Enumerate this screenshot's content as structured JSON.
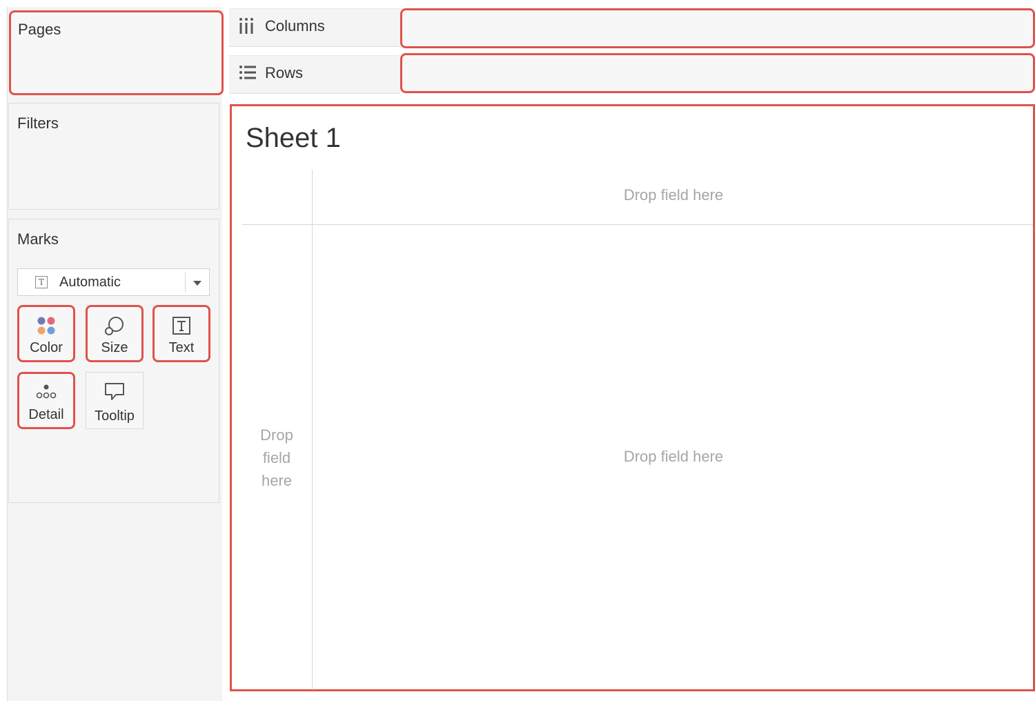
{
  "pages": {
    "title": "Pages"
  },
  "filters": {
    "title": "Filters"
  },
  "marks": {
    "title": "Marks",
    "mark_type": "Automatic",
    "buttons": [
      {
        "label": "Color",
        "icon": "color-dots-icon",
        "highlighted": true
      },
      {
        "label": "Size",
        "icon": "size-icon",
        "highlighted": true
      },
      {
        "label": "Text",
        "icon": "text-icon",
        "highlighted": true
      },
      {
        "label": "Detail",
        "icon": "detail-icon",
        "highlighted": true
      },
      {
        "label": "Tooltip",
        "icon": "tooltip-icon",
        "highlighted": false
      }
    ]
  },
  "shelves": {
    "columns": {
      "label": "Columns",
      "icon": "columns-icon"
    },
    "rows": {
      "label": "Rows",
      "icon": "rows-icon"
    }
  },
  "sheet": {
    "title": "Sheet 1",
    "columns_drop": "Drop field here",
    "rows_drop": [
      "Drop",
      "field",
      "here"
    ],
    "body_drop": "Drop field here"
  },
  "colors": {
    "highlight": "#e0524a",
    "panel_bg": "#f4f4f4",
    "drop_text": "#a6a6a6"
  }
}
